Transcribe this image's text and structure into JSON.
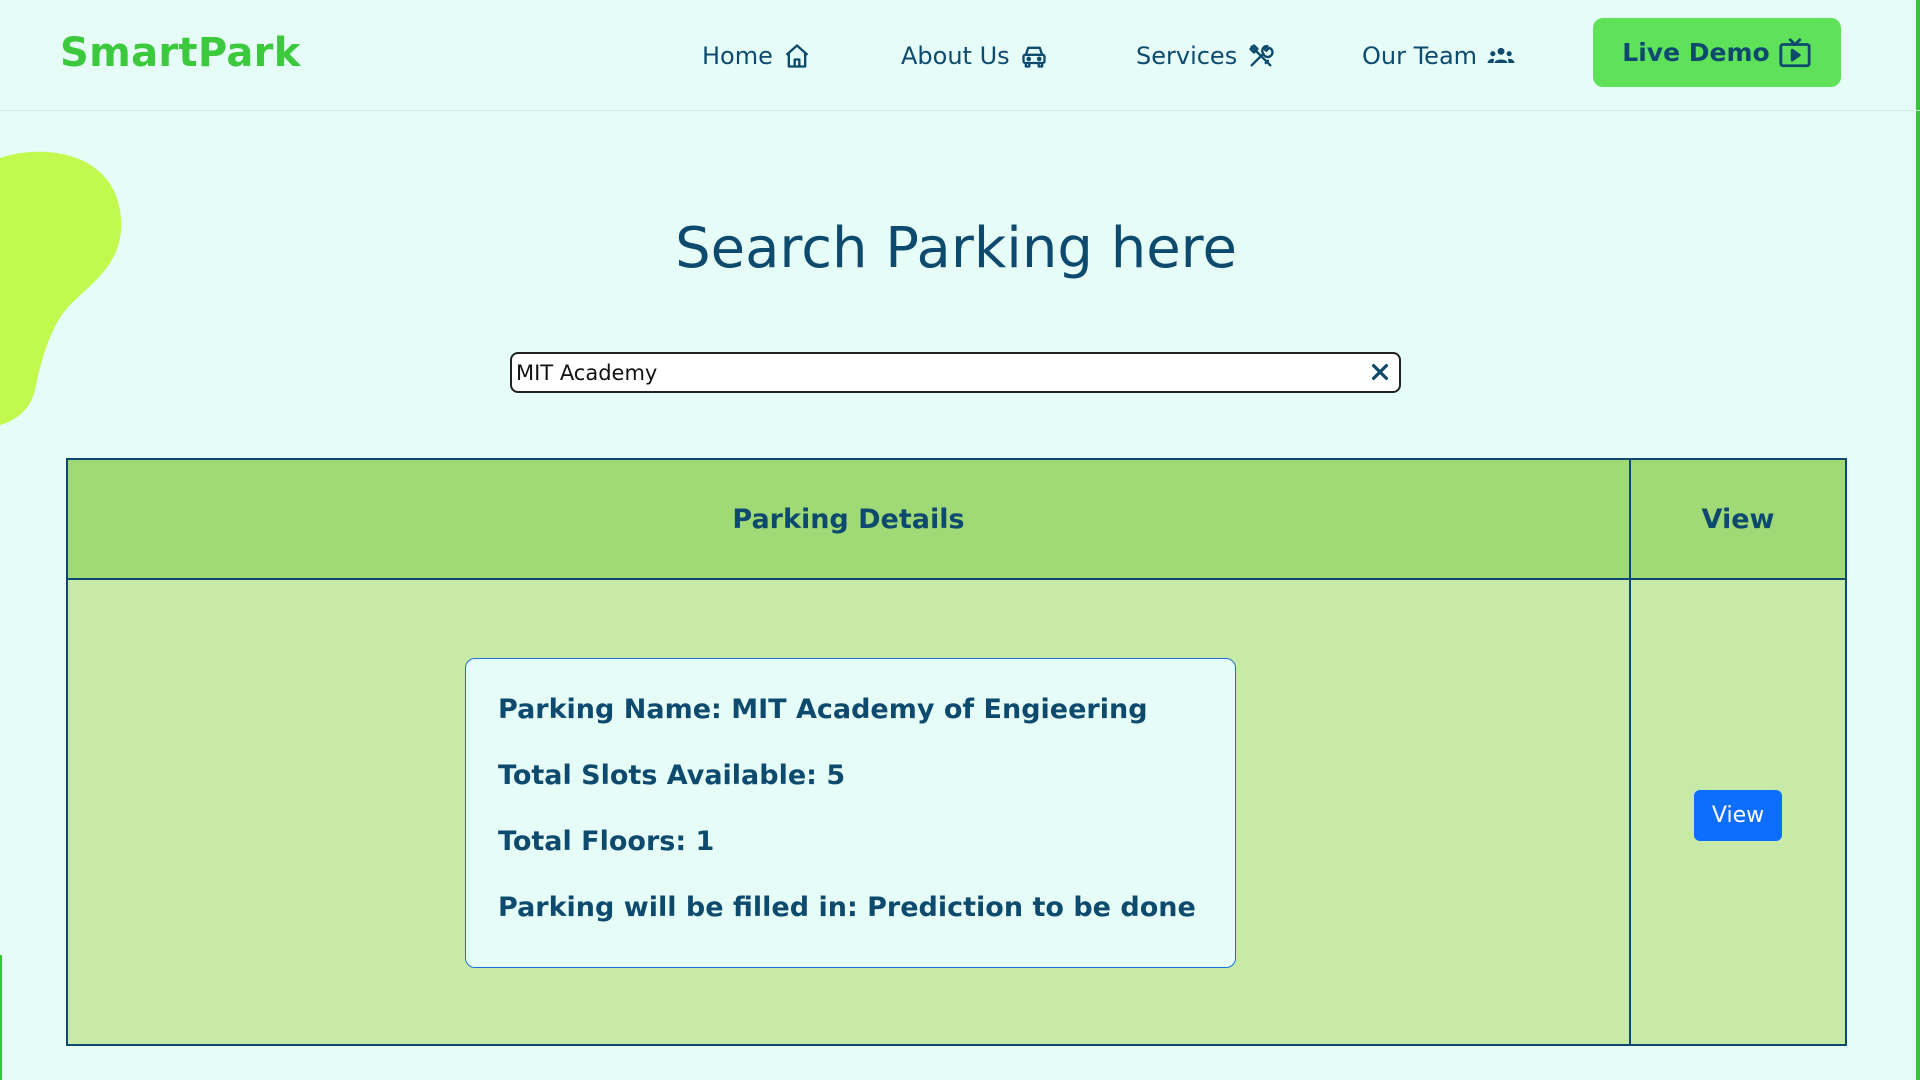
{
  "colors": {
    "brand": "#3cc93d",
    "primary_text": "#0d4a6e",
    "background": "#e6fdf7",
    "demo_button": "#5fe15a",
    "table_header": "#a0da77",
    "table_body": "#c7eaa8",
    "view_button": "#0d6efd",
    "blob": "#c2f94f"
  },
  "navbar": {
    "brand": "SmartPark",
    "items": [
      {
        "label": "Home",
        "icon": "home-icon"
      },
      {
        "label": "About Us",
        "icon": "car-icon"
      },
      {
        "label": "Services",
        "icon": "tools-icon"
      },
      {
        "label": "Our Team",
        "icon": "users-icon"
      }
    ],
    "demo": {
      "label": "Live Demo",
      "icon": "tv-play-icon"
    }
  },
  "main": {
    "heading": "Search Parking here",
    "search": {
      "value": "MIT Academy",
      "clear_icon": "close-icon"
    }
  },
  "table": {
    "headers": {
      "details": "Parking Details",
      "view": "View"
    },
    "rows": [
      {
        "details": [
          "Parking Name: MIT Academy of Engieering",
          "Total Slots Available: 5",
          "Total Floors: 1",
          "Parking will be filled in: Prediction to be done"
        ],
        "action": "View"
      }
    ]
  }
}
